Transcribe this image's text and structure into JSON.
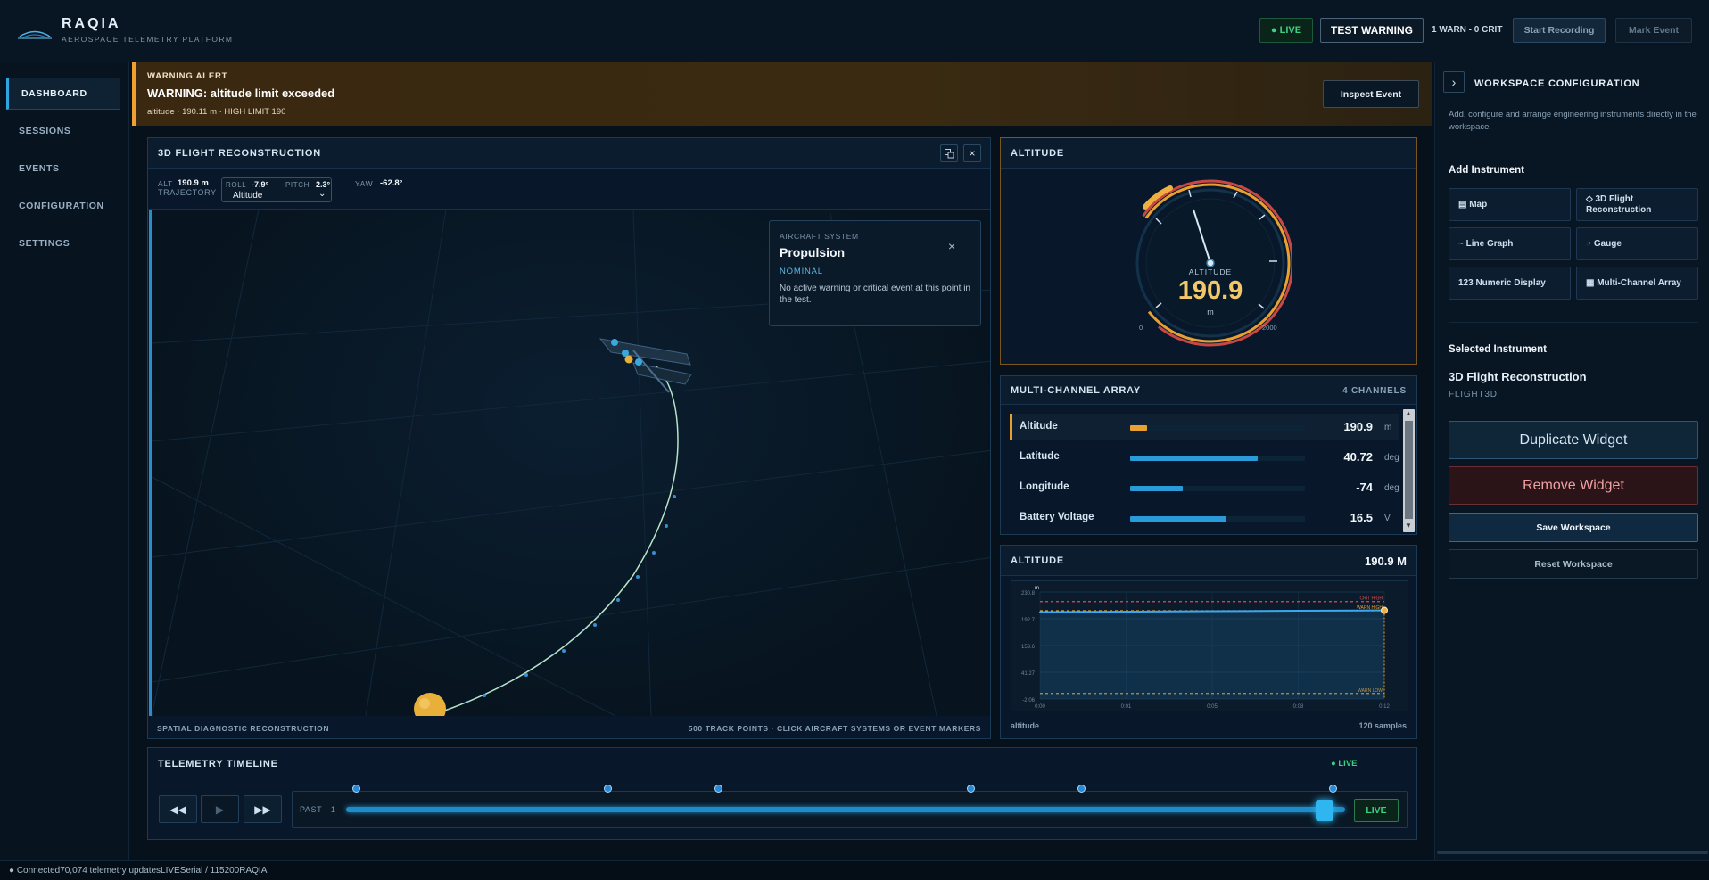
{
  "app": {
    "name": "RAQIA",
    "subtitle": "AEROSPACE TELEMETRY PLATFORM"
  },
  "topbar": {
    "live_label": "● LIVE",
    "test_warning_label": "TEST WARNING",
    "counts": "1 WARN - 0 CRIT",
    "start_recording_label": "Start Recording",
    "mark_event_label": "Mark Event"
  },
  "sidebar": {
    "items": [
      {
        "label": "DASHBOARD",
        "active": true
      },
      {
        "label": "SESSIONS",
        "active": false
      },
      {
        "label": "EVENTS",
        "active": false
      },
      {
        "label": "CONFIGURATION",
        "active": false
      },
      {
        "label": "SETTINGS",
        "active": false
      }
    ]
  },
  "alert": {
    "kicker": "WARNING ALERT",
    "title": "WARNING: altitude limit exceeded",
    "detail": "altitude · 190.11 m · HIGH LIMIT 190",
    "inspect_label": "Inspect Event",
    "accent": "#f0a030"
  },
  "flight": {
    "title": "3D FLIGHT RECONSTRUCTION",
    "alt_label": "ALT",
    "alt_value": "190.9 m",
    "roll_label": "ROLL",
    "roll_value": "-7.9°",
    "pitch_label": "PITCH",
    "pitch_value": "2.3°",
    "yaw_label": "YAW",
    "yaw_value": "-62.8°",
    "trajectory_label": "TRAJECTORY",
    "trajectory_select": "Altitude",
    "popup": {
      "kicker": "AIRCRAFT SYSTEM",
      "title": "Propulsion",
      "status": "NOMINAL",
      "text": "No active warning or critical event at this point in the test."
    },
    "footer_left": "SPATIAL DIAGNOSTIC RECONSTRUCTION",
    "footer_right": "500 TRACK POINTS · CLICK AIRCRAFT SYSTEMS OR EVENT MARKERS"
  },
  "gauge": {
    "title": "ALTITUDE",
    "label": "ALTITUDE",
    "value": "190.9",
    "unit": "m",
    "min_label": "0",
    "max_label": "2000",
    "value_num": 190.9,
    "min": 0,
    "max": 2000
  },
  "multichannel": {
    "title": "MULTI-CHANNEL ARRAY",
    "count_label": "4 CHANNELS",
    "channels": [
      {
        "name": "Altitude",
        "value": "190.9",
        "unit": "m",
        "fill": 0.095,
        "color": "#e8a030",
        "highlight": true
      },
      {
        "name": "Latitude",
        "value": "40.72",
        "unit": "deg",
        "fill": 0.73,
        "color": "#2a9ad8",
        "highlight": false
      },
      {
        "name": "Longitude",
        "value": "-74",
        "unit": "deg",
        "fill": 0.3,
        "color": "#2a9ad8",
        "highlight": false
      },
      {
        "name": "Battery Voltage",
        "value": "16.5",
        "unit": "V",
        "fill": 0.55,
        "color": "#2a9ad8",
        "highlight": false
      }
    ]
  },
  "linegraph": {
    "title": "ALTITUDE",
    "value_label": "190.9 M",
    "footer_left": "altitude",
    "footer_right": "120 samples",
    "unit_label": "m",
    "y_ticks": [
      "230.8",
      "192.7",
      "153.6",
      "41.27",
      "-2.06"
    ],
    "x_ticks": [
      "0:00",
      "0:01",
      "0:05",
      "0:08",
      "0:12"
    ],
    "crit_high_label": "CRIT HIGH",
    "warn_high_label": "WARN HIGH",
    "warn_low_label": "WARN LOW"
  },
  "chart_data": {
    "type": "line",
    "title": "ALTITUDE",
    "xlabel": "",
    "ylabel": "m",
    "x": [
      "0:00",
      "0:01",
      "0:05",
      "0:08",
      "0:12"
    ],
    "series": [
      {
        "name": "altitude",
        "values": [
          187.2,
          188.0,
          189.0,
          190.0,
          190.9
        ]
      }
    ],
    "ylim": [
      -2.06,
      230.8
    ],
    "thresholds": {
      "crit_high": 210,
      "warn_high": 190,
      "warn_low": 10
    },
    "grid": true
  },
  "timeline": {
    "title": "TELEMETRY TIMELINE",
    "live_indicator": "● LIVE",
    "past_label": "PAST · 1",
    "live_button": "LIVE",
    "rewind_icon": "◀◀",
    "play_icon": "▶",
    "forward_icon": "▶▶",
    "position": 1.0
  },
  "config": {
    "collapse_icon": "›",
    "title": "WORKSPACE CONFIGURATION",
    "description": "Add, configure and arrange engineering instruments directly in the workspace.",
    "add_heading": "Add Instrument",
    "instruments": [
      {
        "label": "▤ Map"
      },
      {
        "label": "◇ 3D Flight Reconstruction"
      },
      {
        "label": "~ Line Graph"
      },
      {
        "label": "◔ Gauge"
      },
      {
        "label": "123 Numeric Display"
      },
      {
        "label": "▦ Multi-Channel Array"
      }
    ],
    "selected_heading": "Selected Instrument",
    "selected_name": "3D Flight Reconstruction",
    "selected_id": "FLIGHT3D",
    "duplicate_label": "Duplicate Widget",
    "remove_label": "Remove Widget",
    "save_label": "Save Workspace",
    "reset_label": "Reset Workspace"
  },
  "status": {
    "text": "● Connected70,074 telemetry updatesLIVESerial / 115200RAQIA"
  }
}
